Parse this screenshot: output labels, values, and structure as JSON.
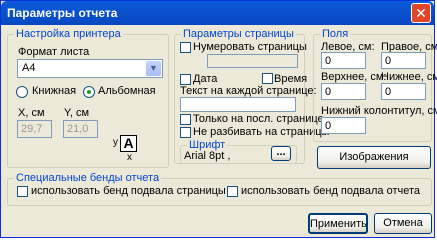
{
  "window": {
    "title": "Параметры отчета",
    "close_symbol": "✕"
  },
  "printer": {
    "legend": "Настройка принтера",
    "format_label": "Формат листа",
    "format_value": "A4",
    "orientation_portrait": "Книжная",
    "orientation_landscape": "Альбомная",
    "orientation_selected": "landscape",
    "x_label": "X, см",
    "y_label": "Y, см",
    "x_value": "29,7",
    "y_value": "21,0",
    "axis_y": "y",
    "axis_x": "x",
    "preview_letter": "A"
  },
  "page": {
    "legend": "Параметры страницы",
    "number_pages": "Нумеровать страницы",
    "date": "Дата",
    "time": "Время",
    "text_each_page": "Текст на каждой странице:",
    "last_page_only": "Только на посл. странице",
    "no_split": "Не разбивать на страницы"
  },
  "font": {
    "legend": "Шрифт",
    "value": "Arial 8pt ,",
    "browse": "..."
  },
  "margins": {
    "legend": "Поля",
    "left_label": "Левое, см:",
    "right_label": "Правое, см:",
    "top_label": "Верхнее, см:",
    "bottom_label": "Нижнее, см:",
    "footer_label": "Нижний колонтитул, см:",
    "left_value": "0",
    "right_value": "0",
    "top_value": "0",
    "bottom_value": "0",
    "footer_value": "0"
  },
  "images_button": "Изображения",
  "bands": {
    "legend": "Специальные бенды отчета",
    "page_footer": "использовать бенд подвала страницы",
    "report_footer": "использовать бенд подвала отчета"
  },
  "buttons": {
    "apply": "Применить",
    "cancel": "Отмена"
  }
}
